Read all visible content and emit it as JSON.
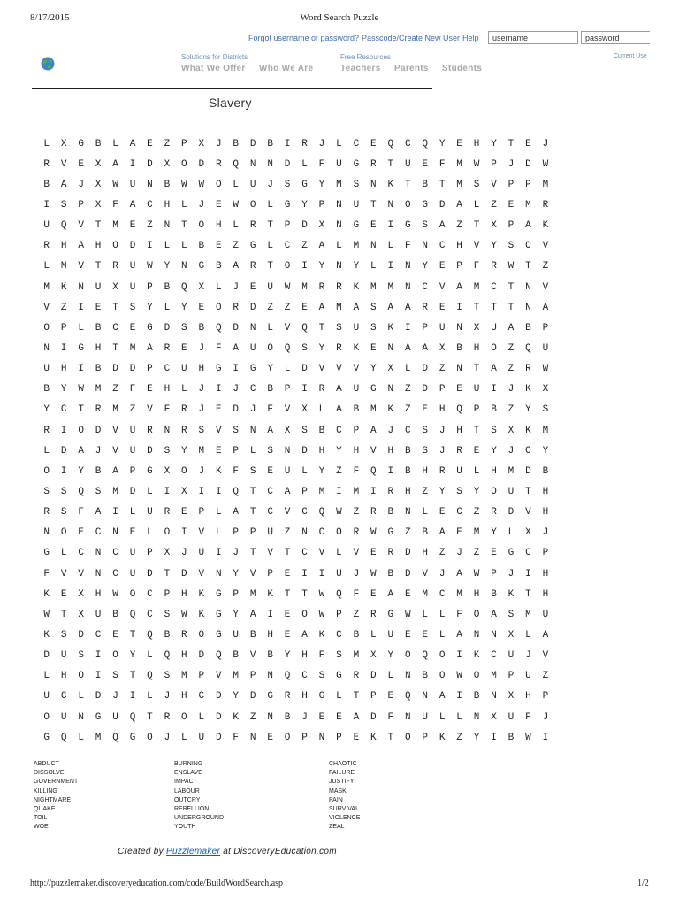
{
  "print_header": {
    "date": "8/17/2015",
    "title": "Word Search Puzzle"
  },
  "top_bar": {
    "forgot": "Forgot username or password?",
    "passcode": "Passcode/Create New User",
    "help": "Help",
    "username_value": "username",
    "password_value": "password"
  },
  "nav": {
    "solutions": "Solutions for Districts",
    "free_resources": "Free Resources",
    "current_user": "Current Use",
    "items": [
      "What We Offer",
      "Who We Are",
      "Teachers",
      "Parents",
      "Students"
    ]
  },
  "puzzle": {
    "title": "Slavery",
    "rows": [
      "LXGBLAEZPXJBDBIRJLCEQCQYEHYTEJ",
      "RVEXAIDXODRQNNDLFUGRTUEFMWPJDW",
      "BAJXWUNBWWOLUJSGYMSNKTBTMSVPPM",
      "ISPXFACHLJEWOLGYPNUTNOGDALZEMR",
      "UQVTMEZNTOHLRTPDXNGEIGSAZTXPAK",
      "RHAHODILLBEZGLCZALMNLFNCHVYSOV",
      "LMVTRUWYNGBARTOIYNYLINYEPFRWTZ",
      "MKNUXUPBQXLJEUWMRRKMMNCVAMCTNV",
      "VZIETSYLYEORDZZEAMASAAREITTTNA",
      "OPLBCEGDSBQDNLVQTSUSKIPUNXUABP",
      "NIGHTMAREJFAUOQSYRKENAAXBHOZQU",
      "UHIBDDPCUHGIGYLDVVVYXLDZNTAZRW",
      "BYWMZFEHLJIJCBPIRAUGNZDPEUIJKX",
      "YCTRMZVFRJEDJFVXLABMKZEHQPBZYS",
      "RIODVURNRSVSNAXSBCPAJCSJHTSXKM",
      "LDAJVUDSYMEPLSNDHYHVHBSJREYJOY",
      "OIYBAPGXOJKFSEULYZFQIBHRULHMDB",
      "SSQSMDLIXIIQTCAPMIMIRHZYSYOUTH",
      "RSFAILUREPLATCVCQWZRBNLECZRDVH",
      "NOECNELOIVLPPUZNCORWGZBAEMYLXJ",
      "GLCNCUPXJUIJTVTCVLVERDHZJZEGCP",
      "FVVNCUDTDVNYVPEIIUJWBDVJAWPJIH",
      "KEXHWOCPHKGPMKTTWQFEAEMCMHBKTH",
      "WTXUBQCSWKGYAIEOWPZRGWLLFOASMU",
      "KSDCETQBROGUBHEAKCBLUEELANNXLA",
      "DUSIOYLQHDQBVBYHFSMXYOQOIKCUJV",
      "LHOISTQSMPVMPNQCSGRDLNBOWOMPUZ",
      "UCLDJILJHCDYDGRHGLTPEQNAIBNXHP",
      "OUNGUQTROLDKZNBJEEADFNULLNXUFJ",
      "GQLMQGOJLUDFNEOPNPEKTOPKZYIBWI"
    ]
  },
  "word_list": {
    "col1": [
      "ABDUCT",
      "DISSOLVE",
      "GOVERNMENT",
      "KILLING",
      "NIGHTMARE",
      "QUAKE",
      "TOIL",
      "WOE"
    ],
    "col2": [
      "BURNING",
      "ENSLAVE",
      "IMPACT",
      "LABOUR",
      "OUTCRY",
      "REBELLION",
      "UNDERGROUND",
      "YOUTH"
    ],
    "col3": [
      "CHAOTIC",
      "FAILURE",
      "JUSTIFY",
      "MASK",
      "PAIN",
      "SURVIVAL",
      "VIOLENCE",
      "ZEAL"
    ]
  },
  "credit": {
    "prefix": "Created by",
    "link": "Puzzlemaker",
    "suffix": "at DiscoveryEducation.com"
  },
  "print_footer": {
    "url": "http://puzzlemaker.discoveryeducation.com/code/BuildWordSearch.asp",
    "page": "1/2"
  },
  "colors": {
    "link_blue": "#3a6fb0",
    "nav_gray": "#a8a8a8"
  }
}
